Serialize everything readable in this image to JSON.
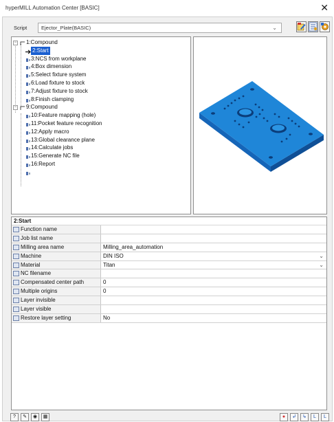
{
  "window": {
    "title": "hyperMILL Automation Center [BASIC]",
    "close_glyph": "✕"
  },
  "script": {
    "label": "Script",
    "value": "Ejector_Plate(BASIC)"
  },
  "toolbar_icons": [
    "edit-script-icon",
    "list-settings-icon",
    "gear-settings-icon"
  ],
  "tree": {
    "items": [
      {
        "label": "1:Compound",
        "level": 0,
        "expander": "−"
      },
      {
        "label": "2:Start",
        "level": 1,
        "selected": true
      },
      {
        "label": "3:NCS from workplane",
        "level": 1
      },
      {
        "label": "4:Box dimension",
        "level": 1
      },
      {
        "label": "5:Select fixture system",
        "level": 1
      },
      {
        "label": "6:Load fixture to stock",
        "level": 1
      },
      {
        "label": "7:Adjust fixture to stock",
        "level": 1
      },
      {
        "label": "8:Finish clamping",
        "level": 1
      },
      {
        "label": "9:Compound",
        "level": 0,
        "expander": "−"
      },
      {
        "label": "10:Feature mapping (hole)",
        "level": 1
      },
      {
        "label": "11:Pocket feature recognition",
        "level": 1
      },
      {
        "label": "12:Apply macro",
        "level": 1
      },
      {
        "label": "13:Global clearance plane",
        "level": 1
      },
      {
        "label": "14:Calculate jobs",
        "level": 1
      },
      {
        "label": "15:Generate NC file",
        "level": 1
      },
      {
        "label": "16:Report",
        "level": 1
      },
      {
        "label": "",
        "level": 1
      }
    ]
  },
  "properties": {
    "header": "2:Start",
    "rows": [
      {
        "name": "Function name",
        "value": "",
        "dropdown": false
      },
      {
        "name": "Job list name",
        "value": "",
        "dropdown": false
      },
      {
        "name": "Milling area name",
        "value": "Milling_area_automation",
        "dropdown": false
      },
      {
        "name": "Machine",
        "value": "DIN ISO",
        "dropdown": true
      },
      {
        "name": "Material",
        "value": "Titan",
        "dropdown": true
      },
      {
        "name": "NC filename",
        "value": "",
        "dropdown": false
      },
      {
        "name": "Compensated center path",
        "value": "0",
        "dropdown": false
      },
      {
        "name": "Multiple origins",
        "value": "0",
        "dropdown": false
      },
      {
        "name": "Layer invisible",
        "value": "",
        "dropdown": false
      },
      {
        "name": "Layer visible",
        "value": "",
        "dropdown": false
      },
      {
        "name": "Restore layer setting",
        "value": "No",
        "dropdown": false
      }
    ]
  },
  "bottom_left": [
    {
      "name": "help-icon",
      "glyph": "?"
    },
    {
      "name": "edit-icon",
      "glyph": "✎"
    },
    {
      "name": "record-icon",
      "glyph": "◉"
    },
    {
      "name": "grid-icon",
      "glyph": "▦"
    }
  ],
  "bottom_right": [
    {
      "name": "stop-icon",
      "glyph": "●"
    },
    {
      "name": "step-into-icon",
      "glyph": "↲"
    },
    {
      "name": "step-over-icon",
      "glyph": "↳"
    },
    {
      "name": "step-out-icon",
      "glyph": "L"
    },
    {
      "name": "run-to-end-icon",
      "glyph": "L"
    }
  ],
  "colors": {
    "selection": "#1a5fd0",
    "part": "#1f86d8",
    "accent_red": "#d33333"
  }
}
